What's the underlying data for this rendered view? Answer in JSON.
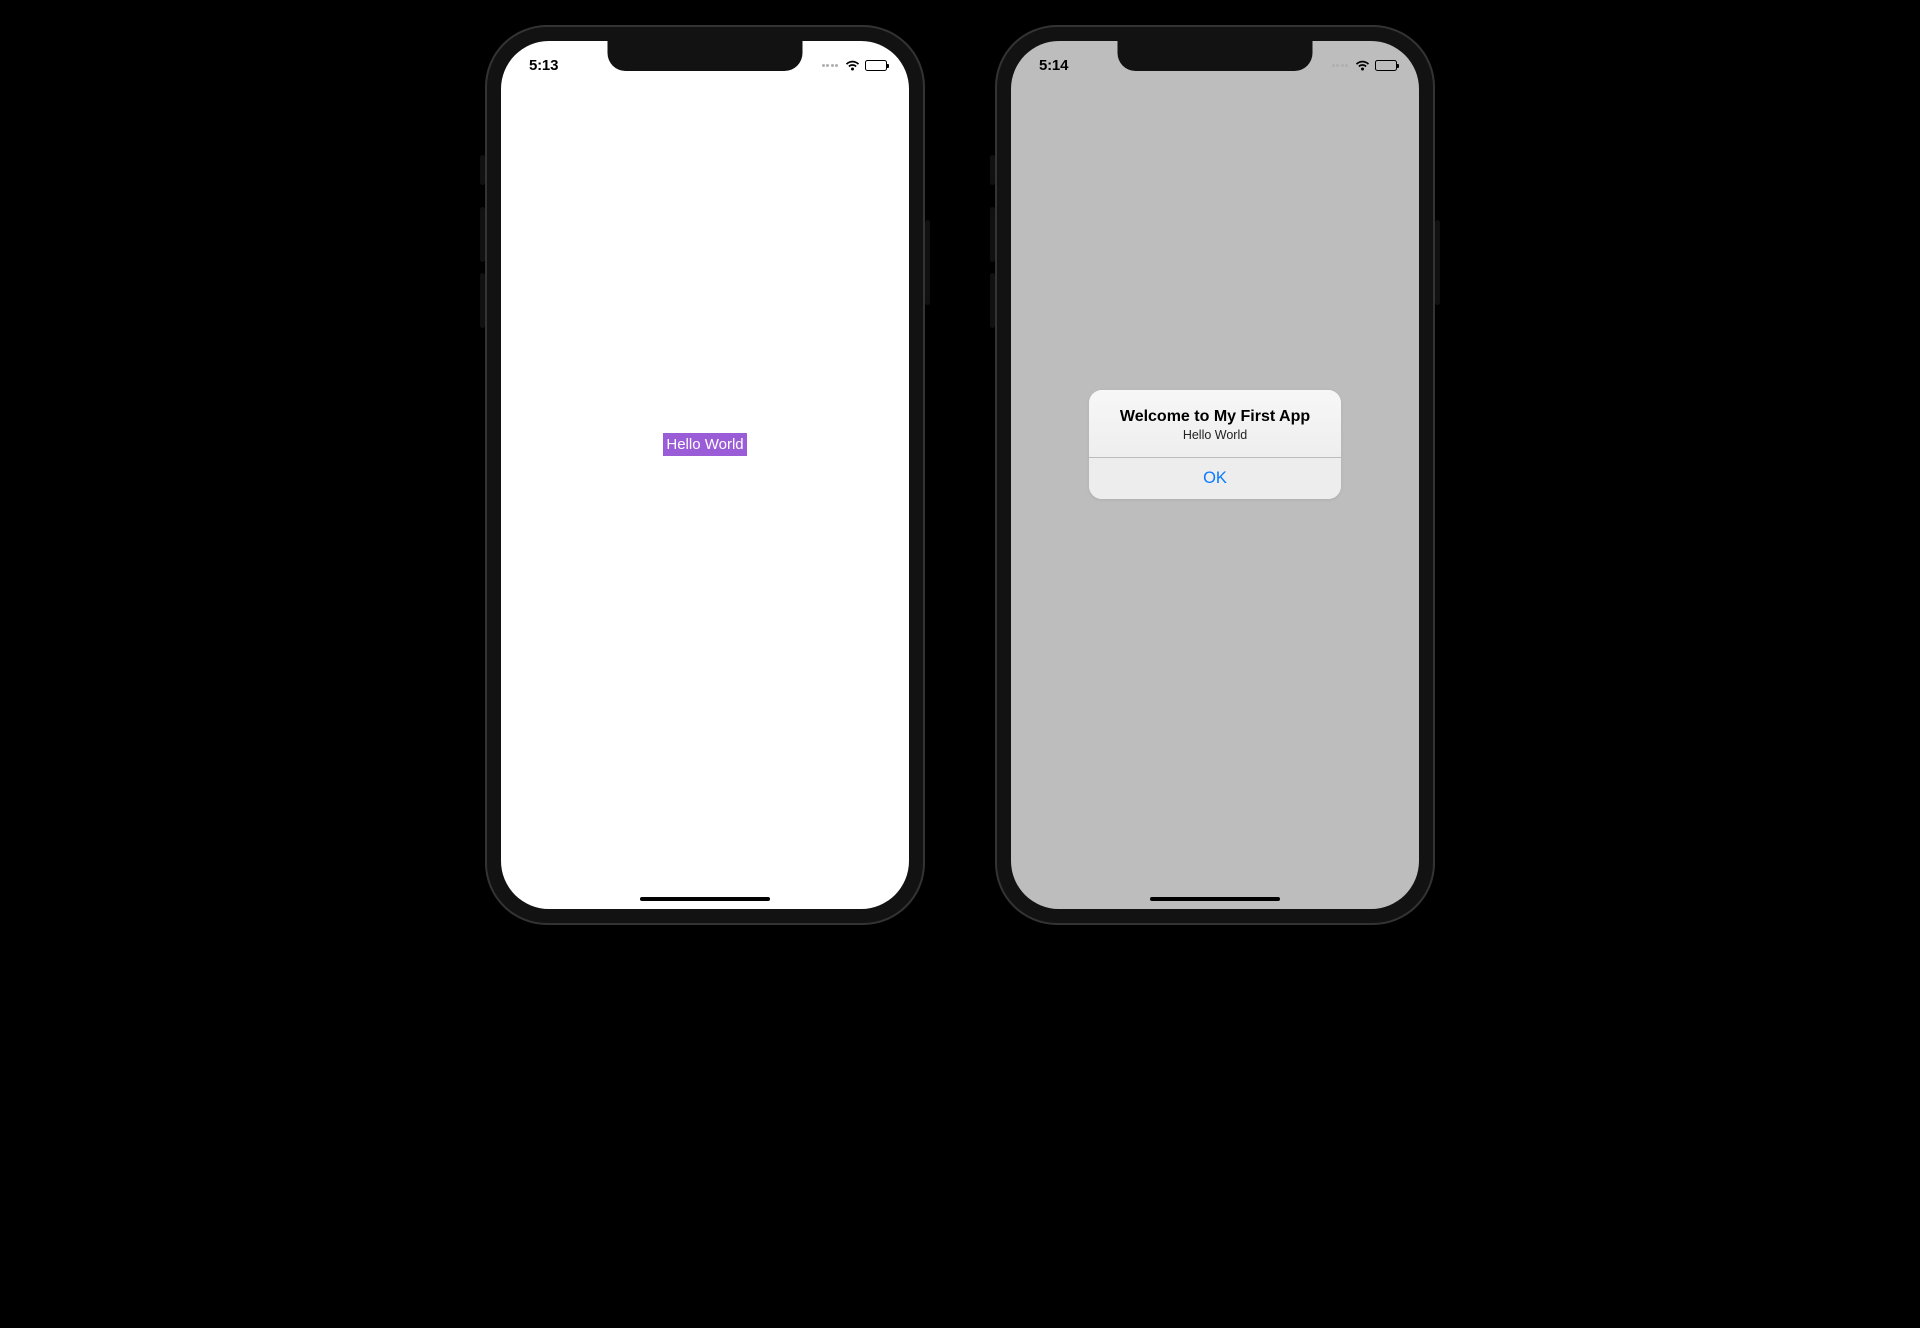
{
  "phone1": {
    "status": {
      "time": "5:13"
    },
    "button_label": "Hello World",
    "colors": {
      "button_bg": "#9b5dd7"
    }
  },
  "phone2": {
    "status": {
      "time": "5:14"
    },
    "alert": {
      "title": "Welcome to My First App",
      "message": "Hello World",
      "ok_label": "OK"
    }
  }
}
